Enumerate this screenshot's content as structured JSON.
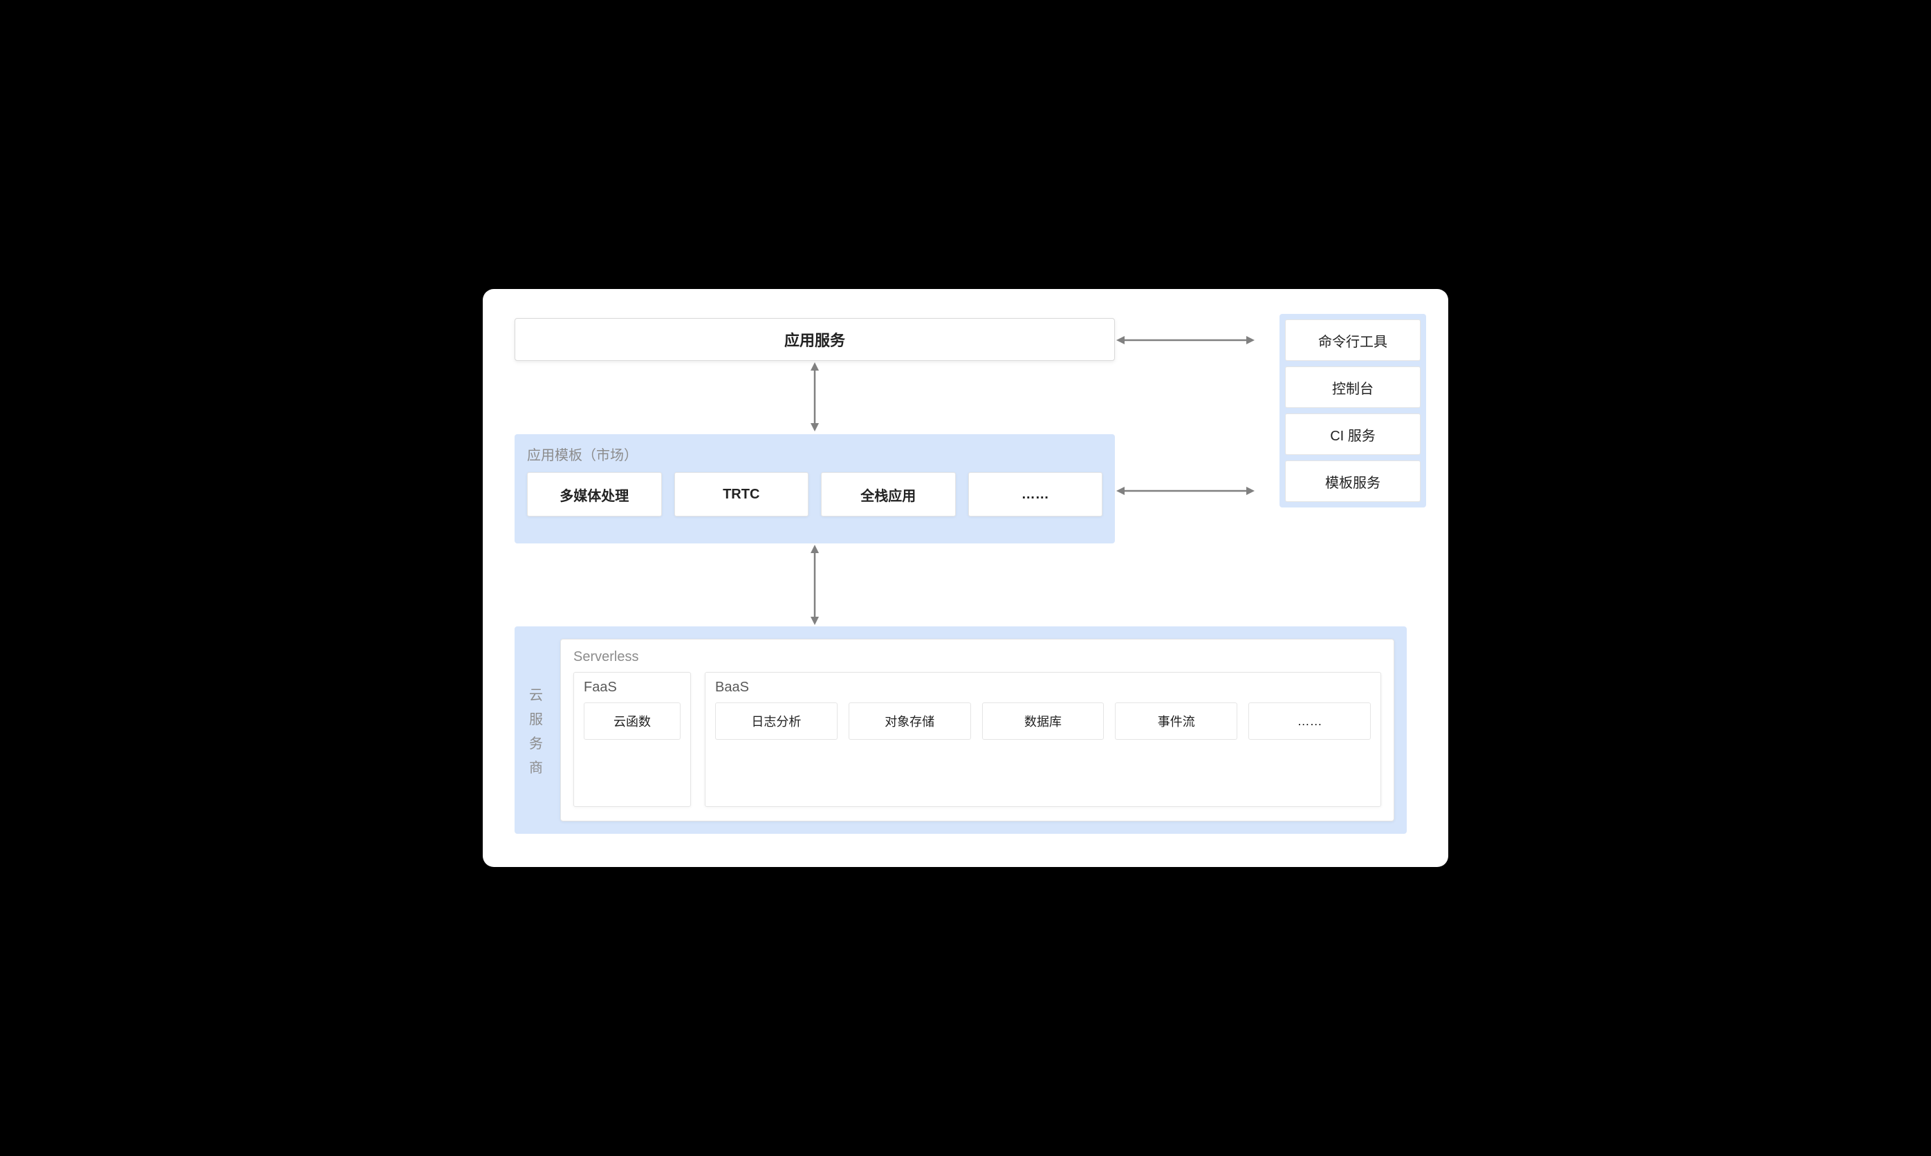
{
  "app_service": {
    "title": "应用服务"
  },
  "templates": {
    "label": "应用模板（市场）",
    "items": [
      "多媒体处理",
      "TRTC",
      "全栈应用",
      "……"
    ]
  },
  "tools": {
    "items": [
      "命令行工具",
      "控制台",
      "CI 服务",
      "模板服务"
    ]
  },
  "cloud": {
    "vertical_label": "云服务商",
    "serverless_label": "Serverless",
    "faas": {
      "label": "FaaS",
      "items": [
        "云函数"
      ]
    },
    "baas": {
      "label": "BaaS",
      "items": [
        "日志分析",
        "对象存储",
        "数据库",
        "事件流",
        "……"
      ]
    }
  }
}
